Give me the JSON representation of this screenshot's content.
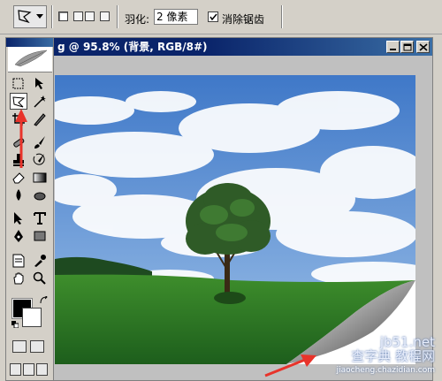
{
  "options_bar": {
    "feather_label": "羽化:",
    "feather_value": "2 像素",
    "antialias_label": "消除锯齿",
    "antialias_checked": true
  },
  "toolbox": {
    "foreground_color": "#000000",
    "background_color": "#ffffff",
    "active_tool": "polygonal-lasso"
  },
  "document": {
    "title": "g @ 95.8% (背景, RGB/8#)"
  },
  "watermark": {
    "site": "jb51.net",
    "line2": "查字典 教程网",
    "line3": "jiaocheng.chazidian.com"
  },
  "colors": {
    "title_bar": "#0a246a",
    "annotation_arrow": "#e8332a",
    "sky": "#5b8fd0",
    "grass": "#2d7a2a"
  }
}
